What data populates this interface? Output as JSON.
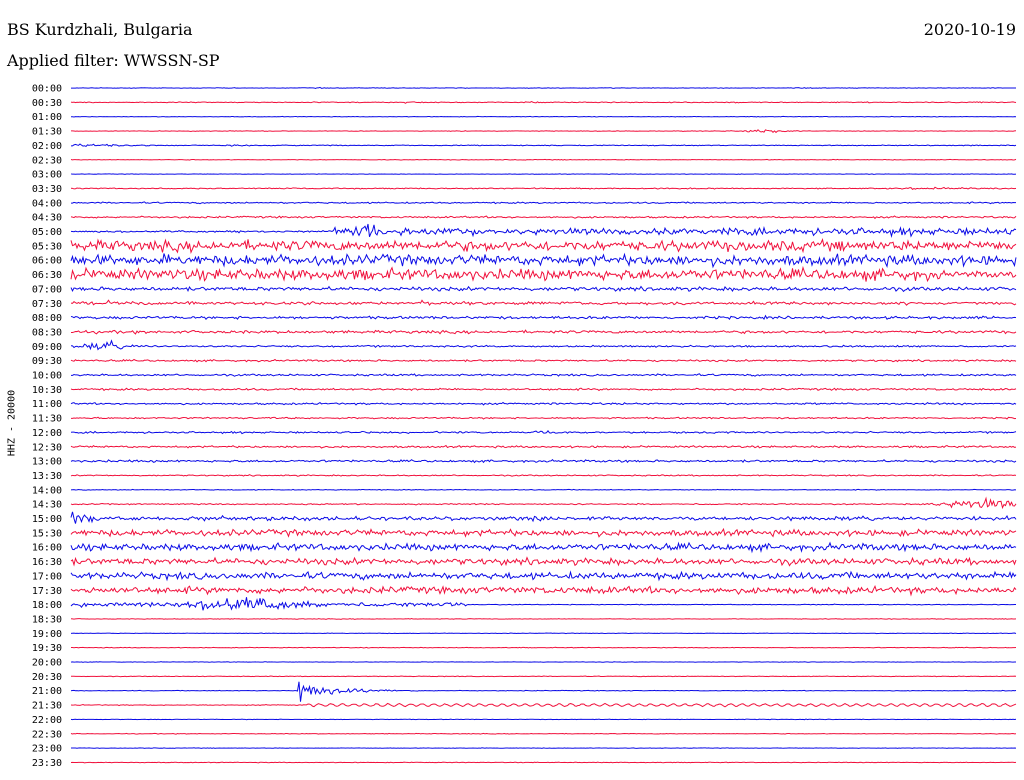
{
  "header": {
    "station": "BS Kurdzhali, Bulgaria",
    "filter": "Applied filter: WWSSN-SP",
    "date": "2020-10-19",
    "channel": "HHZ - 20000"
  },
  "colors": {
    "trace_a": "#0a0ae6",
    "trace_b": "#f0103c",
    "background": "#ffffff"
  },
  "chart_data": {
    "type": "line",
    "title": "BS Kurdzhali, Bulgaria",
    "subtitle": "Applied filter: WWSSN-SP",
    "date": "2020-10-19",
    "ylabel": "HHZ - 20000",
    "xlabel": "",
    "grid": false,
    "legend": "none",
    "rows": [
      {
        "label": "00:00",
        "color": "blue",
        "noise": 0.5,
        "events": [
          {
            "x": 0.265,
            "w": 0.004,
            "amp": 1.5
          }
        ]
      },
      {
        "label": "00:30",
        "color": "red",
        "noise": 0.7,
        "events": [
          {
            "x": 0.36,
            "w": 0.01,
            "amp": 1.2
          },
          {
            "x": 0.49,
            "w": 0.01,
            "amp": 1.1
          },
          {
            "x": 0.66,
            "w": 0.005,
            "amp": 1
          },
          {
            "x": 0.96,
            "w": 0.005,
            "amp": 1.2
          }
        ]
      },
      {
        "label": "01:00",
        "color": "blue",
        "noise": 0.4,
        "events": []
      },
      {
        "label": "01:30",
        "color": "red",
        "noise": 0.5,
        "events": [
          {
            "x": 0.74,
            "w": 0.02,
            "amp": 2.5
          }
        ]
      },
      {
        "label": "02:00",
        "color": "blue",
        "noise": 0.7,
        "events": [
          {
            "x": 0.0,
            "w": 0.05,
            "amp": 2.2
          },
          {
            "x": 0.18,
            "w": 0.01,
            "amp": 1.6
          },
          {
            "x": 0.65,
            "w": 0.01,
            "amp": 1.1
          }
        ]
      },
      {
        "label": "02:30",
        "color": "red",
        "noise": 0.5,
        "events": []
      },
      {
        "label": "03:00",
        "color": "blue",
        "noise": 0.4,
        "events": []
      },
      {
        "label": "03:30",
        "color": "red",
        "noise": 0.9,
        "events": [
          {
            "x": 0.91,
            "w": 0.03,
            "amp": 1.6
          }
        ]
      },
      {
        "label": "04:00",
        "color": "blue",
        "noise": 1.2,
        "events": []
      },
      {
        "label": "04:30",
        "color": "red",
        "noise": 1.5,
        "events": []
      },
      {
        "label": "05:00",
        "color": "blue",
        "noise": 1.6,
        "onset": 0.275,
        "onset_noise": 5.5,
        "events": [
          {
            "x": 0.315,
            "w": 0.02,
            "amp": 9
          }
        ]
      },
      {
        "label": "05:30",
        "color": "red",
        "noise": 8.5,
        "events": []
      },
      {
        "label": "06:00",
        "color": "blue",
        "noise": 8.5,
        "events": []
      },
      {
        "label": "06:30",
        "color": "red",
        "noise": 9,
        "taper": 0.92,
        "taper_noise": 5,
        "events": []
      },
      {
        "label": "07:00",
        "color": "blue",
        "noise": 3.2,
        "events": []
      },
      {
        "label": "07:30",
        "color": "red",
        "noise": 2.4,
        "events": [
          {
            "x": 0.04,
            "w": 0.004,
            "amp": 4
          },
          {
            "x": 0.375,
            "w": 0.004,
            "amp": 5
          }
        ]
      },
      {
        "label": "08:00",
        "color": "blue",
        "noise": 2.2,
        "events": []
      },
      {
        "label": "08:30",
        "color": "red",
        "noise": 2.3,
        "events": []
      },
      {
        "label": "09:00",
        "color": "blue",
        "noise": 1.4,
        "events": [
          {
            "x": 0.04,
            "w": 0.02,
            "amp": 7
          }
        ]
      },
      {
        "label": "09:30",
        "color": "red",
        "noise": 1.5,
        "events": []
      },
      {
        "label": "10:00",
        "color": "blue",
        "noise": 1.6,
        "events": []
      },
      {
        "label": "10:30",
        "color": "red",
        "noise": 1.6,
        "events": []
      },
      {
        "label": "11:00",
        "color": "blue",
        "noise": 1.5,
        "events": []
      },
      {
        "label": "11:30",
        "color": "red",
        "noise": 1.3,
        "events": []
      },
      {
        "label": "12:00",
        "color": "blue",
        "noise": 1.4,
        "events": [
          {
            "x": 0.5,
            "w": 0.02,
            "amp": 2.5
          }
        ]
      },
      {
        "label": "12:30",
        "color": "red",
        "noise": 1.6,
        "events": []
      },
      {
        "label": "13:00",
        "color": "blue",
        "noise": 1.8,
        "events": []
      },
      {
        "label": "13:30",
        "color": "red",
        "noise": 1.0,
        "events": []
      },
      {
        "label": "14:00",
        "color": "blue",
        "noise": 0.6,
        "events": []
      },
      {
        "label": "14:30",
        "color": "red",
        "noise": 1.0,
        "events": [
          {
            "x": 0.965,
            "w": 0.035,
            "amp": 9
          }
        ]
      },
      {
        "label": "15:00",
        "color": "blue",
        "noise": 3.2,
        "events": [
          {
            "x": 0.0,
            "w": 0.018,
            "amp": 12
          }
        ]
      },
      {
        "label": "15:30",
        "color": "red",
        "noise": 5,
        "events": []
      },
      {
        "label": "16:00",
        "color": "blue",
        "noise": 5.5,
        "events": []
      },
      {
        "label": "16:30",
        "color": "red",
        "noise": 5.2,
        "events": []
      },
      {
        "label": "17:00",
        "color": "blue",
        "noise": 5.5,
        "events": []
      },
      {
        "label": "17:30",
        "color": "red",
        "noise": 5.5,
        "events": []
      },
      {
        "label": "18:00",
        "color": "blue",
        "noise": 3.2,
        "taper": 0.42,
        "taper_noise": 0.6,
        "events": [
          {
            "x": 0.18,
            "w": 0.04,
            "amp": 13
          }
        ]
      },
      {
        "label": "18:30",
        "color": "red",
        "noise": 0.5,
        "events": []
      },
      {
        "label": "19:00",
        "color": "blue",
        "noise": 0.4,
        "events": []
      },
      {
        "label": "19:30",
        "color": "red",
        "noise": 0.5,
        "events": []
      },
      {
        "label": "20:00",
        "color": "blue",
        "noise": 0.4,
        "events": []
      },
      {
        "label": "20:30",
        "color": "red",
        "noise": 0.5,
        "events": []
      },
      {
        "label": "21:00",
        "color": "blue",
        "noise": 0.5,
        "events": [
          {
            "x": 0.24,
            "w": 0.13,
            "amp": 28,
            "decay": true
          }
        ]
      },
      {
        "label": "21:30",
        "color": "red",
        "noise": 0.7,
        "wave": {
          "from": 0.25,
          "to": 1.0,
          "amp": 1.2
        },
        "events": []
      },
      {
        "label": "22:00",
        "color": "blue",
        "noise": 0.4,
        "events": []
      },
      {
        "label": "22:30",
        "color": "red",
        "noise": 0.5,
        "events": []
      },
      {
        "label": "23:00",
        "color": "blue",
        "noise": 0.4,
        "events": []
      },
      {
        "label": "23:30",
        "color": "red",
        "noise": 0.5,
        "events": []
      }
    ]
  }
}
